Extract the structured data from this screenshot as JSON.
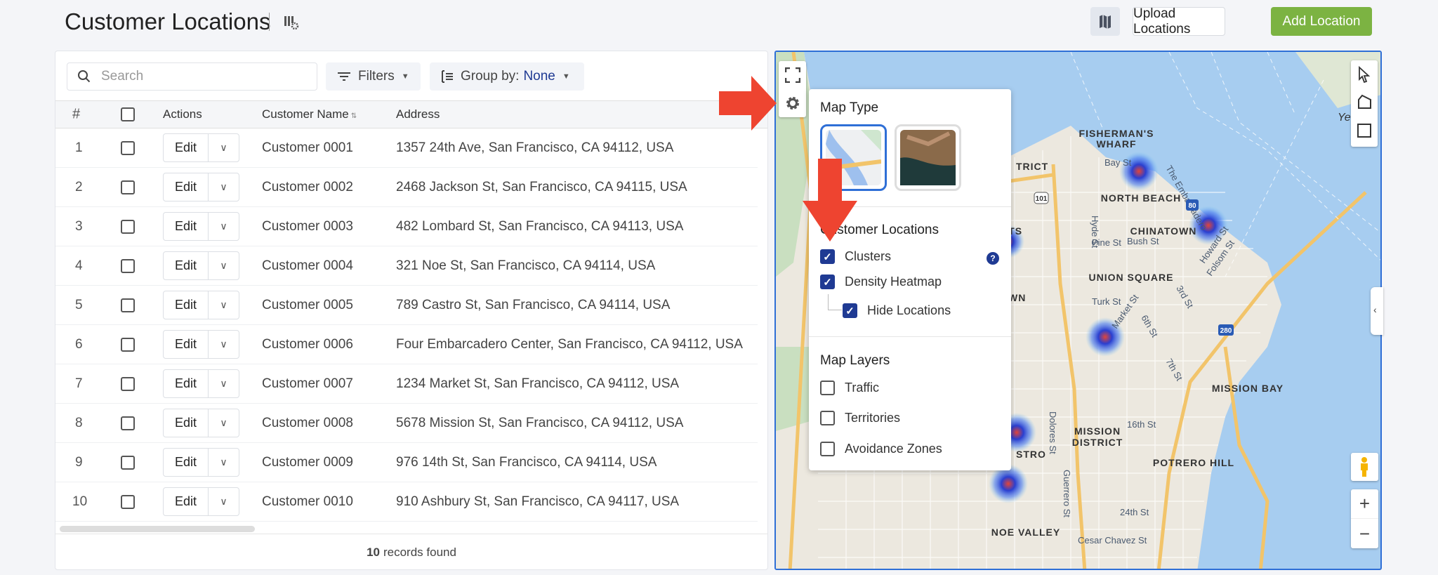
{
  "header": {
    "title": "Customer Locations",
    "upload_label": "Upload Locations",
    "add_label": "Add Location"
  },
  "toolbar": {
    "search_placeholder": "Search",
    "filters_label": "Filters",
    "groupby_label": "Group by:",
    "groupby_value": "None"
  },
  "table": {
    "columns": [
      "#",
      "Actions",
      "Customer Name",
      "Address"
    ],
    "edit_label": "Edit",
    "rows": [
      {
        "n": "1",
        "name": "Customer 0001",
        "address": "1357 24th Ave, San Francisco, CA 94112, USA"
      },
      {
        "n": "2",
        "name": "Customer 0002",
        "address": "2468 Jackson St, San Francisco, CA 94115, USA"
      },
      {
        "n": "3",
        "name": "Customer 0003",
        "address": "482 Lombard St, San Francisco, CA 94113, USA"
      },
      {
        "n": "4",
        "name": "Customer 0004",
        "address": "321 Noe St, San Francisco, CA 94114, USA"
      },
      {
        "n": "5",
        "name": "Customer 0005",
        "address": "789 Castro St, San Francisco, CA 94114, USA"
      },
      {
        "n": "6",
        "name": "Customer 0006",
        "address": "Four Embarcadero Center, San Francisco, CA 94112, USA"
      },
      {
        "n": "7",
        "name": "Customer 0007",
        "address": "1234 Market St, San Francisco, CA 94112, USA"
      },
      {
        "n": "8",
        "name": "Customer 0008",
        "address": "5678 Mission St, San Francisco, CA 94112, USA"
      },
      {
        "n": "9",
        "name": "Customer 0009",
        "address": "976 14th St, San Francisco, CA 94114, USA"
      },
      {
        "n": "10",
        "name": "Customer 0010",
        "address": "910 Ashbury St, San Francisco, CA 94117, USA"
      }
    ],
    "footer_count": "10",
    "footer_text": "records found"
  },
  "map_settings": {
    "map_type_title": "Map Type",
    "customer_locations_title": "Customer Locations",
    "clusters_label": "Clusters",
    "clusters_checked": true,
    "heatmap_label": "Density Heatmap",
    "heatmap_checked": true,
    "hide_locations_label": "Hide Locations",
    "hide_locations_checked": true,
    "map_layers_title": "Map Layers",
    "traffic_label": "Traffic",
    "traffic_checked": false,
    "territories_label": "Territories",
    "territories_checked": false,
    "avoidance_label": "Avoidance Zones",
    "avoidance_checked": false,
    "selected_map_type": "roadmap"
  },
  "map_labels": {
    "fishermans": "FISHERMAN'S",
    "wharf": "WHARF",
    "north_beach": "NORTH BEACH",
    "chinatown": "CHINATOWN",
    "union_square": "UNION SQUARE",
    "mission_bay": "MISSION BAY",
    "mission": "MISSION",
    "district": "DISTRICT",
    "potrero": "POTRERO HILL",
    "noe": "NOE VALLEY",
    "trict": "TRICT",
    "eights": "EIGHTS",
    "antown": "ANTOWN",
    "stro": "STRO",
    "bay_st": "Bay St",
    "hyde": "Hyde St",
    "pine": "Pine St",
    "bush": "Bush St",
    "turk": "Turk St",
    "market": "Market St",
    "sixth": "6th St",
    "third": "3rd St",
    "seventh": "7th St",
    "howard": "Howard St",
    "folsom": "Folsom St",
    "sixteenth": "16th St",
    "twentyfourth": "24th St",
    "cesar": "Cesar Chavez St",
    "dolores": "Dolores St",
    "guerrero": "Guerrero St",
    "embarcadero": "The Embarcadero",
    "yerba": "Yerb",
    "hw101": "101",
    "hw80": "80",
    "hw280": "280"
  },
  "colors": {
    "accent": "#2f6fd6",
    "add_button": "#7cb342",
    "checkbox": "#1f3a93",
    "annotation_arrow": "#ee4430"
  }
}
